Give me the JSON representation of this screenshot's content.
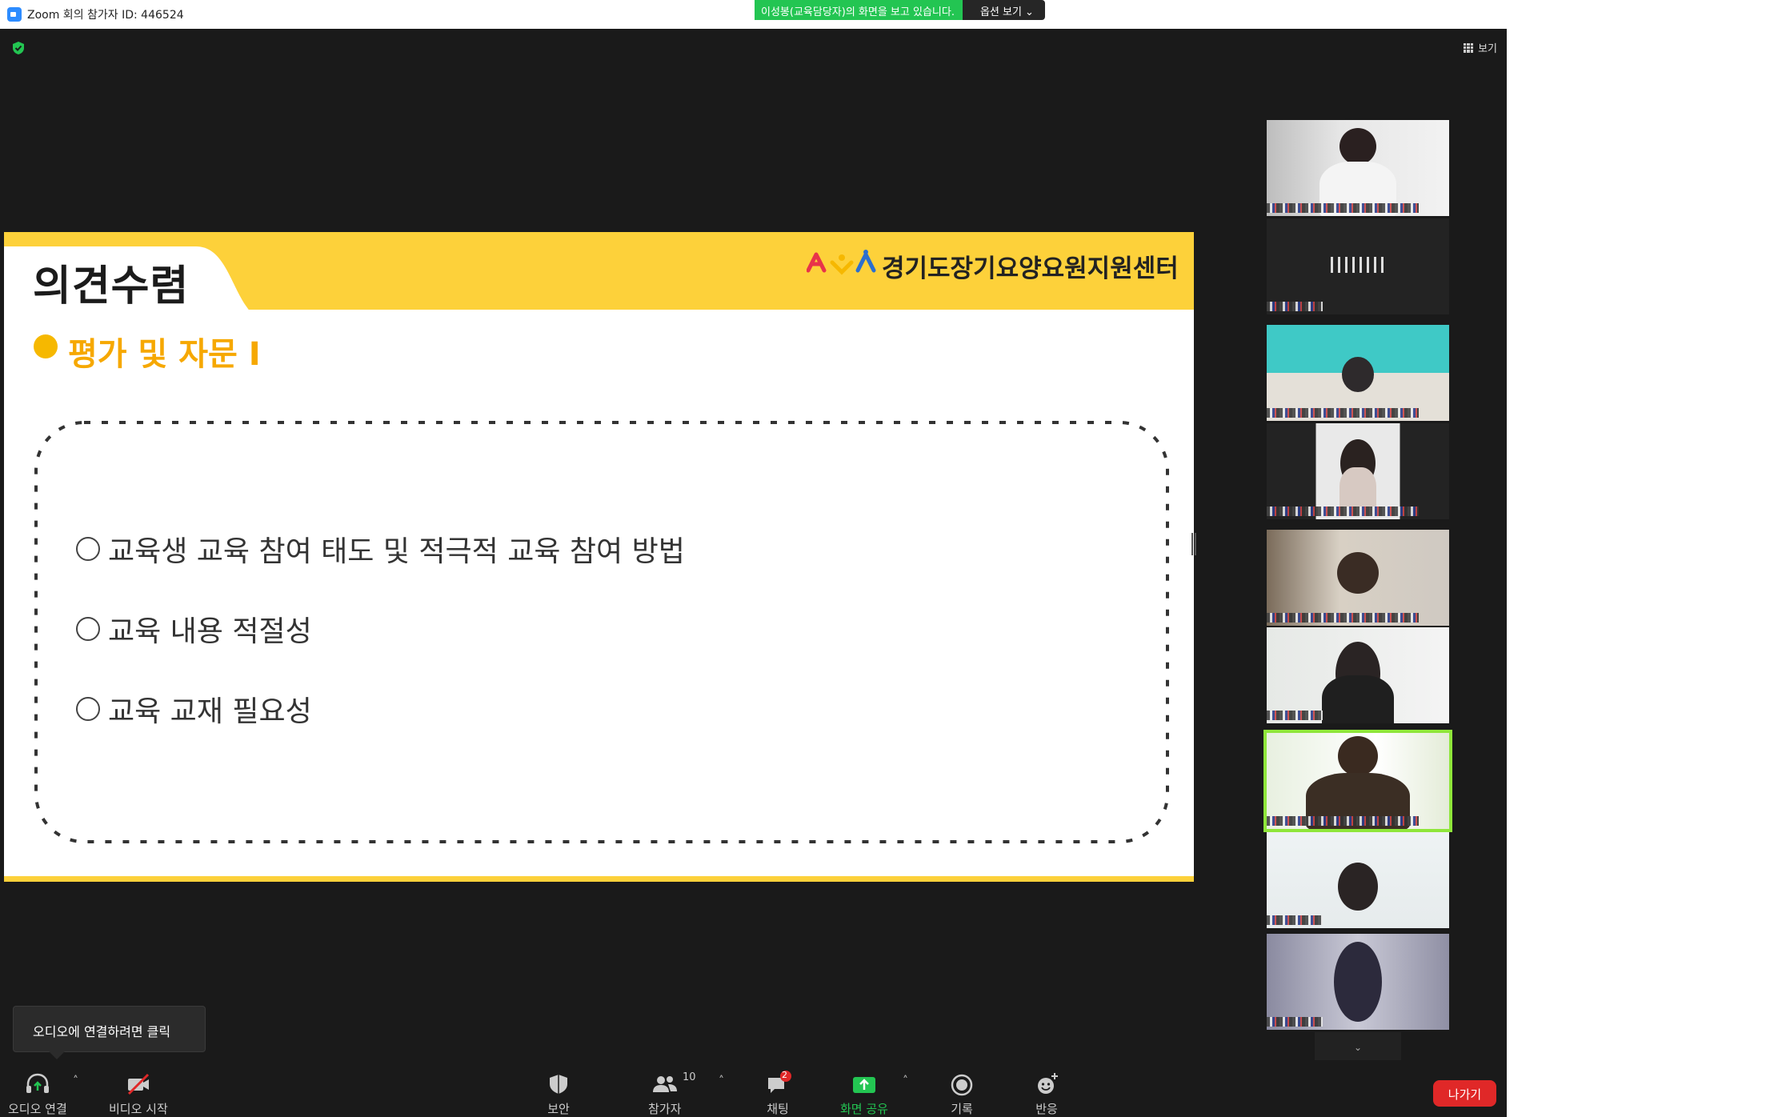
{
  "window": {
    "title": "Zoom 회의 참가자 ID: 446524",
    "viewing_banner": "이성봉(교육담당자)의 화면을 보고 있습니다.",
    "view_options": "옵션 보기 ⌄"
  },
  "meeting": {
    "view_label": "보기",
    "security_color": "#23c552"
  },
  "slide": {
    "title": "의견수렴",
    "org_name": "경기도장기요양요원지원센터",
    "section_title": "평가 및 자문 I",
    "items": [
      "교육생 교육 참여 태도 및 적극적 교육 참여 방법",
      "교육 내용 적절성",
      "교육 교재 필요성"
    ],
    "accent_color": "#fdd13a"
  },
  "participants_panel": {
    "scroll_label": "⌄"
  },
  "tooltip": {
    "text": "오디오에 연결하려면 클릭"
  },
  "toolbar": {
    "audio": "오디오 연결",
    "video": "비디오 시작",
    "security": "보안",
    "participants": "참가자",
    "participants_count": "10",
    "chat": "채팅",
    "chat_badge": "2",
    "share": "화면 공유",
    "record": "기록",
    "reactions": "반응",
    "leave": "나가기"
  }
}
